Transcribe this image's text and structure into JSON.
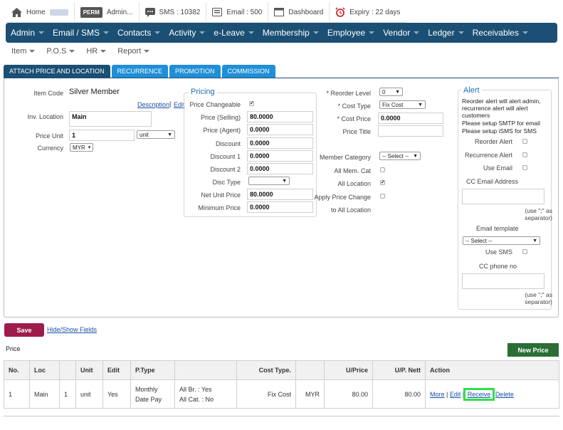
{
  "topbar": {
    "home": "Home",
    "perm_badge": "PERM",
    "admin": "Admin...",
    "sms": "SMS : 10382",
    "email": "Email : 500",
    "dashboard": "Dashboard",
    "expiry": "Expiry : 22 days"
  },
  "nav": [
    "Admin",
    "Email / SMS",
    "Contacts",
    "Activity",
    "e-Leave",
    "Membership",
    "Employee",
    "Vendor",
    "Ledger",
    "Receivables"
  ],
  "subnav": [
    "Item",
    "P.O.S",
    "HR",
    "Report"
  ],
  "tabs": [
    "ATTACH PRICE AND LOCATION",
    "RECURRENCE",
    "PROMOTION",
    "COMMISSION"
  ],
  "form": {
    "item_code_label": "Item Code",
    "item_code_value": "Silver Member",
    "description_link": "Description",
    "edit_link": "Edit",
    "sep": "|",
    "inv_location_label": "Inv. Location",
    "inv_location_value": "Main",
    "price_unit_label": "Price Unit",
    "price_unit_value": "1",
    "unit_select": "unit",
    "currency_label": "Currency",
    "currency_select": "MYR"
  },
  "pricing": {
    "legend": "Pricing",
    "price_changeable_label": "Price Changeable",
    "price_selling_label": "Price (Selling)",
    "price_selling": "80.0000",
    "price_agent_label": "Price (Agent)",
    "price_agent": "0.0000",
    "discount_label": "Discount",
    "discount": "0.0000",
    "discount1_label": "Discount 1",
    "discount1": "0.0000",
    "discount2_label": "Discount 2",
    "discount2": "0.0000",
    "disc_type_label": "Disc Type",
    "net_unit_price_label": "Net Unit Price",
    "net_unit_price": "80.0000",
    "minimum_price_label": "Minimum Price",
    "minimum_price": "0.0000"
  },
  "middle": {
    "reorder_level_label": "* Reorder Level",
    "reorder_level": "0",
    "cost_type_label": "* Cost Type",
    "cost_type": "Fix Cost",
    "cost_price_label": "* Cost Price",
    "cost_price": "0.0000",
    "price_title_label": "Price Title",
    "member_category_label": "Member Category",
    "member_category": "-- Select --",
    "all_mem_cat_label": "All Mem. Cat",
    "all_location_label": "All Location",
    "apply_price_change_label": "Apply Price Change",
    "to_all_location_label": "to All Location"
  },
  "alert": {
    "legend": "Alert",
    "note1": "Reorder alert will alert admin, recurrence alert will alert customers",
    "note2": "Please setup SMTP for email",
    "note3": "Please setup iSMS for SMS",
    "reorder_alert_label": "Reorder Alert",
    "recurrence_alert_label": "Recurrence Alert",
    "use_email_label": "Use Email",
    "cc_email_label": "CC Email Address",
    "separator_hint1": "(use \";\" as separator)",
    "email_template_label": "Email template",
    "email_template": "-- Select --",
    "use_sms_label": "Use SMS",
    "cc_phone_label": "CC phone no",
    "separator_hint2": "(use \";\" as separator)"
  },
  "actions": {
    "save": "Save",
    "hide_show": "Hide/Show Fields",
    "price_heading": "Price",
    "new_price": "New Price"
  },
  "table": {
    "headers": [
      "No.",
      "Loc",
      "",
      "Unit",
      "Edit",
      "P.Type",
      "",
      "Cost Type.",
      "",
      "U/Price",
      "U/P. Nett",
      "Action"
    ],
    "row": {
      "no": "1",
      "loc": "Main",
      "qty": "1",
      "unit": "unit",
      "edit": "Yes",
      "ptype1": "Monthly",
      "ptype2": "Date Pay",
      "br": "All Br. : Yes",
      "cat": "All Cat. : No",
      "cost_type": "Fix Cost",
      "currency": "MYR",
      "uprice": "80.00",
      "upnett": "80.00",
      "more": "More",
      "edit_link": "Edit",
      "receive": "Receive",
      "delete": "Delete",
      "sep": "|"
    }
  },
  "colors": {
    "navbar": "#1b4f74",
    "tab": "#1f8fd6",
    "save": "#9d1c4c",
    "new_price": "#2a6e35",
    "highlight": "#2ee04a"
  }
}
